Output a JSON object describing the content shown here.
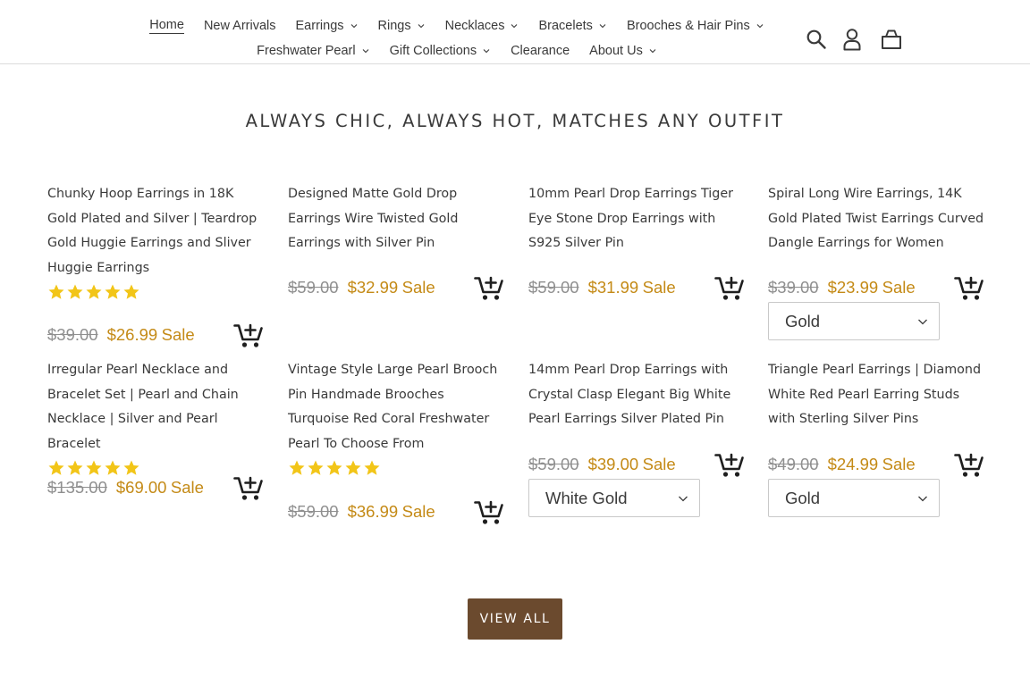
{
  "colors": {
    "accent_sale": "#c48a16",
    "star": "#f2c518",
    "button_bg": "#6b4a2e",
    "text": "#3a3a3a",
    "compare_price": "#8f8f8f"
  },
  "nav": {
    "row1": [
      {
        "label": "Home",
        "active": true,
        "dropdown": false
      },
      {
        "label": "New Arrivals",
        "dropdown": false
      },
      {
        "label": "Earrings",
        "dropdown": true
      },
      {
        "label": "Rings",
        "dropdown": true
      },
      {
        "label": "Necklaces",
        "dropdown": true
      },
      {
        "label": "Bracelets",
        "dropdown": true
      },
      {
        "label": "Brooches & Hair Pins",
        "dropdown": true
      }
    ],
    "row2": [
      {
        "label": "Freshwater Pearl",
        "dropdown": true
      },
      {
        "label": "Gift Collections",
        "dropdown": true
      },
      {
        "label": "Clearance",
        "dropdown": false
      },
      {
        "label": "About Us",
        "dropdown": true
      }
    ]
  },
  "header_icons": [
    "search-icon",
    "account-icon",
    "cart-icon"
  ],
  "section": {
    "title": "ALWAYS CHIC, ALWAYS HOT, MATCHES ANY OUTFIT",
    "view_all_label": "VIEW ALL"
  },
  "products": [
    {
      "title": "Chunky Hoop Earrings in 18K Gold Plated and Silver | Teardrop Gold Huggie Earrings and Sliver Huggie Earrings",
      "rating_stars": 5,
      "compare_price": "$39.00",
      "sale_price": "$26.99",
      "sale_label": "Sale",
      "variant": null
    },
    {
      "title": "Designed Matte Gold Drop Earrings Wire Twisted Gold Earrings with Silver Pin",
      "rating_stars": 0,
      "compare_price": "$59.00",
      "sale_price": "$32.99",
      "sale_label": "Sale",
      "variant": null
    },
    {
      "title": "10mm Pearl Drop Earrings Tiger Eye Stone Drop Earrings with S925 Silver Pin",
      "rating_stars": 0,
      "compare_price": "$59.00",
      "sale_price": "$31.99",
      "sale_label": "Sale",
      "variant": null
    },
    {
      "title": "Spiral Long Wire Earrings, 14K Gold Plated Twist Earrings Curved Dangle Earrings for Women",
      "rating_stars": 0,
      "compare_price": "$39.00",
      "sale_price": "$23.99",
      "sale_label": "Sale",
      "variant": "Gold"
    },
    {
      "title": "Irregular Pearl Necklace and Bracelet Set | Pearl and Chain Necklace | Silver and Pearl Bracelet",
      "rating_stars": 5,
      "compare_price": "$135.00",
      "sale_price": "$69.00",
      "sale_label": "Sale",
      "variant": null
    },
    {
      "title": "Vintage Style Large Pearl Brooch Pin Handmade Brooches Turquoise Red Coral Freshwater Pearl To Choose From",
      "rating_stars": 5,
      "compare_price": "$59.00",
      "sale_price": "$36.99",
      "sale_label": "Sale",
      "variant": null
    },
    {
      "title": "14mm Pearl Drop Earrings with Crystal Clasp Elegant Big White Pearl Earrings Silver Plated Pin",
      "rating_stars": 0,
      "compare_price": "$59.00",
      "sale_price": "$39.00",
      "sale_label": "Sale",
      "variant": "White Gold"
    },
    {
      "title": "Triangle Pearl Earrings | Diamond White Red Pearl Earring Studs with Sterling Silver Pins",
      "rating_stars": 0,
      "compare_price": "$49.00",
      "sale_price": "$24.99",
      "sale_label": "Sale",
      "variant": "Gold"
    }
  ]
}
